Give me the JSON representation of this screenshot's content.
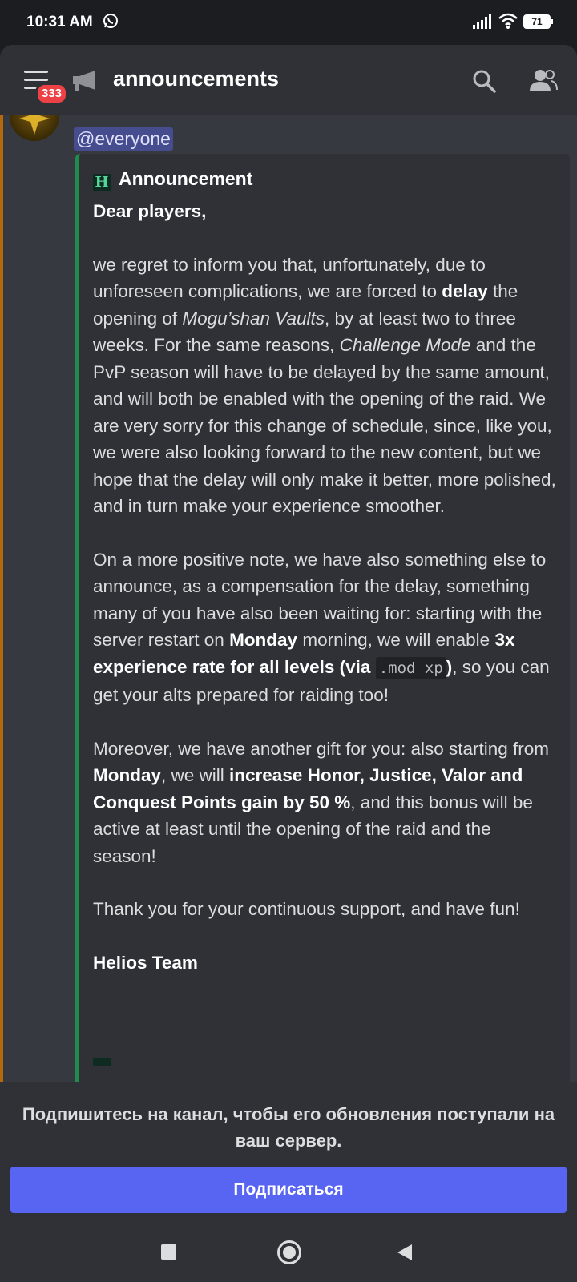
{
  "status_bar": {
    "time": "10:31 AM",
    "battery": "71",
    "icons": [
      "whatsapp-icon",
      "signal-icon",
      "wifi-icon",
      "battery-icon"
    ]
  },
  "header": {
    "menu_badge": "333",
    "channel_name": "announcements",
    "icons": [
      "hamburger-icon",
      "megaphone-icon",
      "search-icon",
      "members-icon"
    ]
  },
  "message": {
    "mention": "@everyone",
    "embed": {
      "author_icon": "H",
      "author": "Announcement",
      "greeting": "Dear players,",
      "p1": [
        "we regret to inform you that, unfortunately, due to unforeseen complications, we are forced to ",
        "delay",
        " the opening of ",
        "Mogu’shan Vaults",
        ", by at least two to three weeks. For the same reasons, ",
        "Challenge Mode",
        " and the PvP season will have to be delayed by the same amount, and will both be enabled with the opening of the raid. We are very sorry for this change of schedule, since, like you, we were also looking forward to the new content, but we hope that the delay will only make it better, more polished, and in turn make your experience smoother."
      ],
      "p2": [
        "On a more positive note, we have also something else to announce, as a compensation for the delay, something many of you have also been waiting for: starting with the server restart on ",
        "Monday",
        " morning, we will enable ",
        "3x experience rate for all levels (via ",
        ".mod xp",
        ")",
        ", so you can get your alts prepared for raiding too!"
      ],
      "p3": [
        "Moreover, we have another gift for you: also starting from ",
        "Monday",
        ", we will ",
        "increase Honor, Justice, Valor and Conquest Points gain by 50 %",
        ", and this bonus will be active at least until the opening of the raid and the season!"
      ],
      "p4": "Thank you for your continuous support, and have fun!",
      "signature": "Helios Team"
    }
  },
  "subscribe": {
    "text": "Подпишитесь на канал, чтобы его обновления поступали на ваш сервер.",
    "button": "Подписаться"
  },
  "colors": {
    "accent": "#5865f2",
    "embed_border": "#1f8b4c",
    "badge": "#ed4245"
  }
}
